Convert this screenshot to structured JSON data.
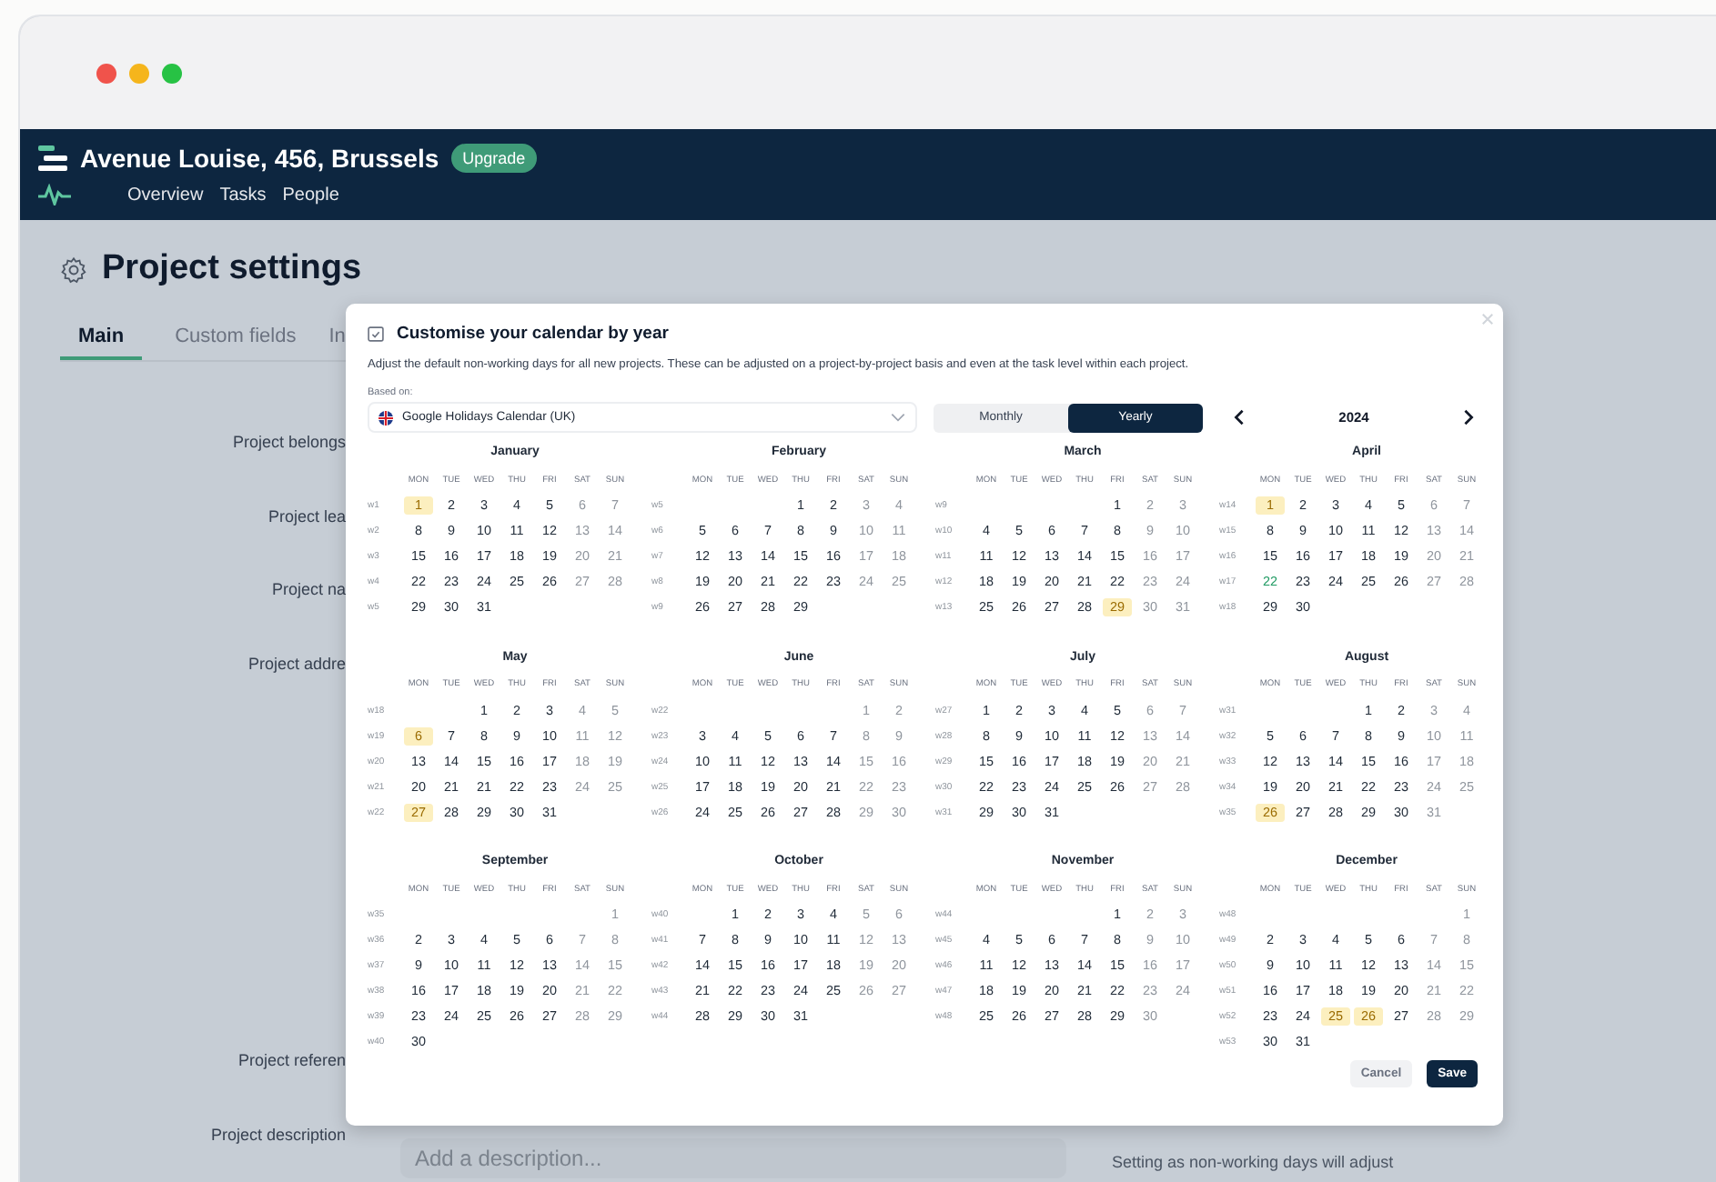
{
  "header": {
    "title": "Avenue Louise, 456, Brussels",
    "badge": "Upgrade",
    "nav": [
      {
        "label": "Overview",
        "selected": false
      },
      {
        "label": "Tasks",
        "selected": false
      },
      {
        "label": "People",
        "selected": false
      }
    ]
  },
  "page": {
    "title": "Project settings",
    "tabs": [
      {
        "label": "Main",
        "selected": true
      },
      {
        "label": "Custom fields",
        "selected": false
      },
      {
        "label": "In",
        "selected": false
      }
    ],
    "fields": [
      {
        "label": "Project belongs"
      },
      {
        "label": "Project lea"
      },
      {
        "label": "Project na"
      },
      {
        "label": "Project addre"
      },
      {
        "label": "Project referen"
      },
      {
        "label": "Project description",
        "placeholder": "Add a description..."
      }
    ],
    "note": "Setting as non-working days will adjust"
  },
  "modal": {
    "title": "Customise your calendar by year",
    "description": "Adjust the default non-working days for all new projects. These can be adjusted on a project-by-project basis and even at the task level within each project.",
    "based_on_label": "Based on:",
    "calendar": "Google Holidays Calendar (UK)",
    "views": [
      {
        "label": "Monthly",
        "selected": false
      },
      {
        "label": "Yearly",
        "selected": true
      }
    ],
    "year": "2024",
    "months": [
      {
        "name": "January",
        "weekdays": [
          "MON",
          "TUE",
          "WED",
          "THU",
          "FRI",
          "SAT",
          "SUN"
        ],
        "weeks": [
          {
            "label": "w1",
            "mon": {
              "day": "1",
              "holiday": true,
              "today": false
            },
            "tue": "2",
            "wed": "3",
            "thu": "4",
            "fri": "5",
            "sat": "6",
            "sun": "7"
          },
          {
            "label": "w2",
            "mon": "8",
            "tue": "9",
            "wed": "10",
            "thu": "11",
            "fri": "12",
            "sat": "13",
            "sun": "14"
          },
          {
            "label": "w3",
            "mon": "15",
            "tue": "16",
            "wed": "17",
            "thu": "18",
            "fri": "19",
            "sat": "20",
            "sun": "21"
          },
          {
            "label": "w4",
            "mon": "22",
            "tue": "23",
            "wed": "24",
            "thu": "25",
            "fri": "26",
            "sat": "27",
            "sun": "28"
          },
          {
            "label": "w5",
            "mon": "29",
            "tue": "30",
            "wed": "31"
          }
        ]
      },
      {
        "name": "February",
        "weekdays": [
          "MON",
          "TUE",
          "WED",
          "THU",
          "FRI",
          "SAT",
          "SUN"
        ],
        "weeks": [
          {
            "label": "w5",
            "thu": "1",
            "fri": "2",
            "sat": "3",
            "sun": "4"
          },
          {
            "label": "w6",
            "mon": "5",
            "tue": "6",
            "wed": "7",
            "thu": "8",
            "fri": "9",
            "sat": "10",
            "sun": "11"
          },
          {
            "label": "w7",
            "mon": "12",
            "tue": "13",
            "wed": "14",
            "thu": "15",
            "fri": "16",
            "sat": "17",
            "sun": "18"
          },
          {
            "label": "w8",
            "mon": "19",
            "tue": "20",
            "wed": "21",
            "thu": "22",
            "fri": "23",
            "sat": "24",
            "sun": "25"
          },
          {
            "label": "w9",
            "mon": "26",
            "tue": "27",
            "wed": "28",
            "thu": "29"
          }
        ]
      },
      {
        "name": "March",
        "weekdays": [
          "MON",
          "TUE",
          "WED",
          "THU",
          "FRI",
          "SAT",
          "SUN"
        ],
        "weeks": [
          {
            "label": "w9",
            "fri": "1",
            "sat": "2",
            "sun": "3"
          },
          {
            "label": "w10",
            "mon": "4",
            "tue": "5",
            "wed": "6",
            "thu": "7",
            "fri": "8",
            "sat": "9",
            "sun": "10"
          },
          {
            "label": "w11",
            "mon": "11",
            "tue": "12",
            "wed": "13",
            "thu": "14",
            "fri": "15",
            "sat": "16",
            "sun": "17"
          },
          {
            "label": "w12",
            "mon": "18",
            "tue": "19",
            "wed": "20",
            "thu": "21",
            "fri": "22",
            "sat": "23",
            "sun": "24"
          },
          {
            "label": "w13",
            "mon": "25",
            "tue": "26",
            "wed": "27",
            "thu": "28",
            "fri": {
              "day": "29",
              "holiday": true,
              "today": false
            },
            "sat": "30",
            "sun": "31"
          }
        ]
      },
      {
        "name": "April",
        "weekdays": [
          "MON",
          "TUE",
          "WED",
          "THU",
          "FRI",
          "SAT",
          "SUN"
        ],
        "weeks": [
          {
            "label": "w14",
            "mon": {
              "day": "1",
              "holiday": true,
              "today": false
            },
            "tue": "2",
            "wed": "3",
            "thu": "4",
            "fri": "5",
            "sat": "6",
            "sun": "7"
          },
          {
            "label": "w15",
            "mon": "8",
            "tue": "9",
            "wed": "10",
            "thu": "11",
            "fri": "12",
            "sat": "13",
            "sun": "14"
          },
          {
            "label": "w16",
            "mon": "15",
            "tue": "16",
            "wed": "17",
            "thu": "18",
            "fri": "19",
            "sat": "20",
            "sun": "21"
          },
          {
            "label": "w17",
            "mon": {
              "day": "22",
              "holiday": false,
              "today": true
            },
            "tue": "23",
            "wed": "24",
            "thu": "25",
            "fri": "26",
            "sat": "27",
            "sun": "28"
          },
          {
            "label": "w18",
            "mon": "29",
            "tue": "30"
          }
        ]
      },
      {
        "name": "May",
        "weekdays": [
          "MON",
          "TUE",
          "WED",
          "THU",
          "FRI",
          "SAT",
          "SUN"
        ],
        "weeks": [
          {
            "label": "w18",
            "wed": "1",
            "thu": "2",
            "fri": "3",
            "sat": "4",
            "sun": "5"
          },
          {
            "label": "w19",
            "mon": {
              "day": "6",
              "holiday": true,
              "today": false
            },
            "tue": "7",
            "wed": "8",
            "thu": "9",
            "fri": "10",
            "sat": "11",
            "sun": "12"
          },
          {
            "label": "w20",
            "mon": "13",
            "tue": "14",
            "wed": "15",
            "thu": "16",
            "fri": "17",
            "sat": "18",
            "sun": "19"
          },
          {
            "label": "w21",
            "mon": "20",
            "tue": "21",
            "wed": "21",
            "thu": "22",
            "fri": "23",
            "sat": "24",
            "sun": "25"
          },
          {
            "label": "w22",
            "mon": {
              "day": "27",
              "holiday": true,
              "today": false
            },
            "tue": "28",
            "wed": "29",
            "thu": "30",
            "fri": "31"
          }
        ]
      },
      {
        "name": "June",
        "weekdays": [
          "MON",
          "TUE",
          "WED",
          "THU",
          "FRI",
          "SAT",
          "SUN"
        ],
        "weeks": [
          {
            "label": "w22",
            "sat": "1",
            "sun": "2"
          },
          {
            "label": "w23",
            "mon": "3",
            "tue": "4",
            "wed": "5",
            "thu": "6",
            "fri": "7",
            "sat": "8",
            "sun": "9"
          },
          {
            "label": "w24",
            "mon": "10",
            "tue": "11",
            "wed": "12",
            "thu": "13",
            "fri": "14",
            "sat": "15",
            "sun": "16"
          },
          {
            "label": "w25",
            "mon": "17",
            "tue": "18",
            "wed": "19",
            "thu": "20",
            "fri": "21",
            "sat": "22",
            "sun": "23"
          },
          {
            "label": "w26",
            "mon": "24",
            "tue": "25",
            "wed": "26",
            "thu": "27",
            "fri": "28",
            "sat": "29",
            "sun": "30"
          }
        ]
      },
      {
        "name": "July",
        "weekdays": [
          "MON",
          "TUE",
          "WED",
          "THU",
          "FRI",
          "SAT",
          "SUN"
        ],
        "weeks": [
          {
            "label": "w27",
            "mon": "1",
            "tue": "2",
            "wed": "3",
            "thu": "4",
            "fri": "5",
            "sat": "6",
            "sun": "7"
          },
          {
            "label": "w28",
            "mon": "8",
            "tue": "9",
            "wed": "10",
            "thu": "11",
            "fri": "12",
            "sat": "13",
            "sun": "14"
          },
          {
            "label": "w29",
            "mon": "15",
            "tue": "16",
            "wed": "17",
            "thu": "18",
            "fri": "19",
            "sat": "20",
            "sun": "21"
          },
          {
            "label": "w30",
            "mon": "22",
            "tue": "23",
            "wed": "24",
            "thu": "25",
            "fri": "26",
            "sat": "27",
            "sun": "28"
          },
          {
            "label": "w31",
            "mon": "29",
            "tue": "30",
            "wed": "31"
          }
        ]
      },
      {
        "name": "August",
        "weekdays": [
          "MON",
          "TUE",
          "WED",
          "THU",
          "FRI",
          "SAT",
          "SUN"
        ],
        "weeks": [
          {
            "label": "w31",
            "thu": "1",
            "fri": "2",
            "sat": "3",
            "sun": "4"
          },
          {
            "label": "w32",
            "mon": "5",
            "tue": "6",
            "wed": "7",
            "thu": "8",
            "fri": "9",
            "sat": "10",
            "sun": "11"
          },
          {
            "label": "w33",
            "mon": "12",
            "tue": "13",
            "wed": "14",
            "thu": "15",
            "fri": "16",
            "sat": "17",
            "sun": "18"
          },
          {
            "label": "w34",
            "mon": "19",
            "tue": "20",
            "wed": "21",
            "thu": "22",
            "fri": "23",
            "sat": "24",
            "sun": "25"
          },
          {
            "label": "w35",
            "mon": {
              "day": "26",
              "holiday": true,
              "today": false
            },
            "tue": "27",
            "wed": "28",
            "thu": "29",
            "fri": "30",
            "sat": "31"
          }
        ]
      },
      {
        "name": "September",
        "weekdays": [
          "MON",
          "TUE",
          "WED",
          "THU",
          "FRI",
          "SAT",
          "SUN"
        ],
        "weeks": [
          {
            "label": "w35",
            "sun": "1"
          },
          {
            "label": "w36",
            "mon": "2",
            "tue": "3",
            "wed": "4",
            "thu": "5",
            "fri": "6",
            "sat": "7",
            "sun": "8"
          },
          {
            "label": "w37",
            "mon": "9",
            "tue": "10",
            "wed": "11",
            "thu": "12",
            "fri": "13",
            "sat": "14",
            "sun": "15"
          },
          {
            "label": "w38",
            "mon": "16",
            "tue": "17",
            "wed": "18",
            "thu": "19",
            "fri": "20",
            "sat": "21",
            "sun": "22"
          },
          {
            "label": "w39",
            "mon": "23",
            "tue": "24",
            "wed": "25",
            "thu": "26",
            "fri": "27",
            "sat": "28",
            "sun": "29"
          },
          {
            "label": "w40",
            "mon": "30"
          }
        ]
      },
      {
        "name": "October",
        "weekdays": [
          "MON",
          "TUE",
          "WED",
          "THU",
          "FRI",
          "SAT",
          "SUN"
        ],
        "weeks": [
          {
            "label": "w40",
            "tue": "1",
            "wed": "2",
            "thu": "3",
            "fri": "4",
            "sat": "5",
            "sun": "6"
          },
          {
            "label": "w41",
            "mon": "7",
            "tue": "8",
            "wed": "9",
            "thu": "10",
            "fri": "11",
            "sat": "12",
            "sun": "13"
          },
          {
            "label": "w42",
            "mon": "14",
            "tue": "15",
            "wed": "16",
            "thu": "17",
            "fri": "18",
            "sat": "19",
            "sun": "20"
          },
          {
            "label": "w43",
            "mon": "21",
            "tue": "22",
            "wed": "23",
            "thu": "24",
            "fri": "25",
            "sat": "26",
            "sun": "27"
          },
          {
            "label": "w44",
            "mon": "28",
            "tue": "29",
            "wed": "30",
            "thu": "31"
          }
        ]
      },
      {
        "name": "November",
        "weekdays": [
          "MON",
          "TUE",
          "WED",
          "THU",
          "FRI",
          "SAT",
          "SUN"
        ],
        "weeks": [
          {
            "label": "w44",
            "fri": "1",
            "sat": "2",
            "sun": "3"
          },
          {
            "label": "w45",
            "mon": "4",
            "tue": "5",
            "wed": "6",
            "thu": "7",
            "fri": "8",
            "sat": "9",
            "sun": "10"
          },
          {
            "label": "w46",
            "mon": "11",
            "tue": "12",
            "wed": "13",
            "thu": "14",
            "fri": "15",
            "sat": "16",
            "sun": "17"
          },
          {
            "label": "w47",
            "mon": "18",
            "tue": "19",
            "wed": "20",
            "thu": "21",
            "fri": "22",
            "sat": "23",
            "sun": "24"
          },
          {
            "label": "w48",
            "mon": "25",
            "tue": "26",
            "wed": "27",
            "thu": "28",
            "fri": "29",
            "sat": "30"
          }
        ]
      },
      {
        "name": "December",
        "weekdays": [
          "MON",
          "TUE",
          "WED",
          "THU",
          "FRI",
          "SAT",
          "SUN"
        ],
        "weeks": [
          {
            "label": "w48",
            "sun": "1"
          },
          {
            "label": "w49",
            "mon": "2",
            "tue": "3",
            "wed": "4",
            "thu": "5",
            "fri": "6",
            "sat": "7",
            "sun": "8"
          },
          {
            "label": "w50",
            "mon": "9",
            "tue": "10",
            "wed": "11",
            "thu": "12",
            "fri": "13",
            "sat": "14",
            "sun": "15"
          },
          {
            "label": "w51",
            "mon": "16",
            "tue": "17",
            "wed": "18",
            "thu": "19",
            "fri": "20",
            "sat": "21",
            "sun": "22"
          },
          {
            "label": "w52",
            "mon": "23",
            "tue": "24",
            "wed": {
              "day": "25",
              "holiday": true,
              "today": false
            },
            "thu": {
              "day": "26",
              "holiday": true,
              "today": false
            },
            "fri": "27",
            "sat": "28",
            "sun": "29"
          },
          {
            "label": "w53",
            "mon": "30",
            "tue": "31"
          }
        ]
      }
    ],
    "buttons": [
      {
        "label": "Cancel",
        "kind": "secondary"
      },
      {
        "label": "Save",
        "kind": "primary"
      }
    ]
  }
}
